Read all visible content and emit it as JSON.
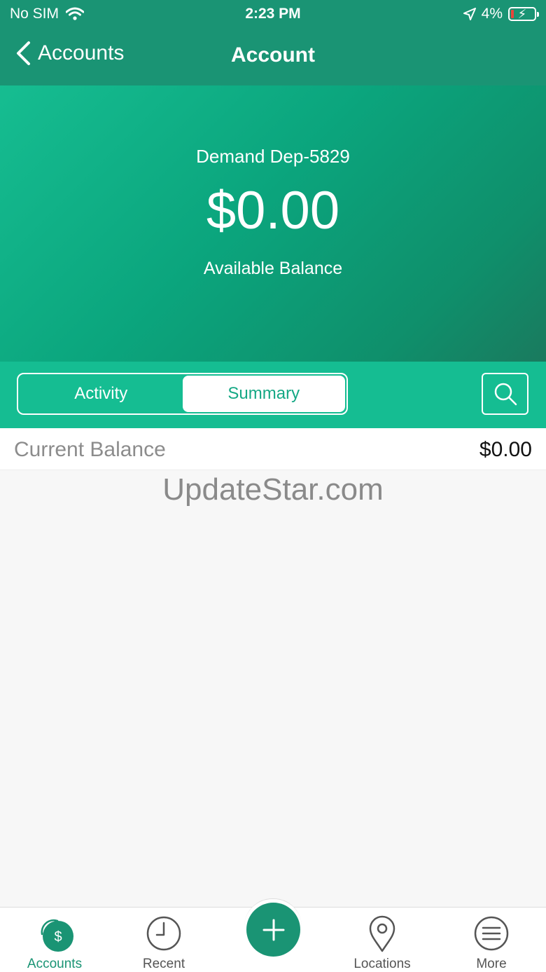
{
  "status_bar": {
    "carrier": "No SIM",
    "time": "2:23 PM",
    "battery": "4%"
  },
  "nav": {
    "back_label": "Accounts",
    "title": "Account"
  },
  "account": {
    "name": "Demand Dep-5829",
    "balance": "$0.00",
    "balance_label": "Available Balance"
  },
  "segments": {
    "activity": "Activity",
    "summary": "Summary",
    "selected": "Summary"
  },
  "summary": {
    "rows": [
      {
        "label": "Current Balance",
        "value": "$0.00"
      }
    ]
  },
  "watermark": "UpdateStar.com",
  "tabbar": {
    "items": [
      {
        "label": "Accounts",
        "icon": "dollar-coin-icon"
      },
      {
        "label": "Recent",
        "icon": "clock-icon"
      },
      {
        "label": "",
        "icon": "plus-icon"
      },
      {
        "label": "Locations",
        "icon": "map-pin-icon"
      },
      {
        "label": "More",
        "icon": "menu-icon"
      }
    ],
    "active": "Accounts"
  },
  "colors": {
    "header": "#1a9474",
    "hero": "#16bd91",
    "segment_bar": "#15bd92",
    "accent": "#1a9474"
  }
}
